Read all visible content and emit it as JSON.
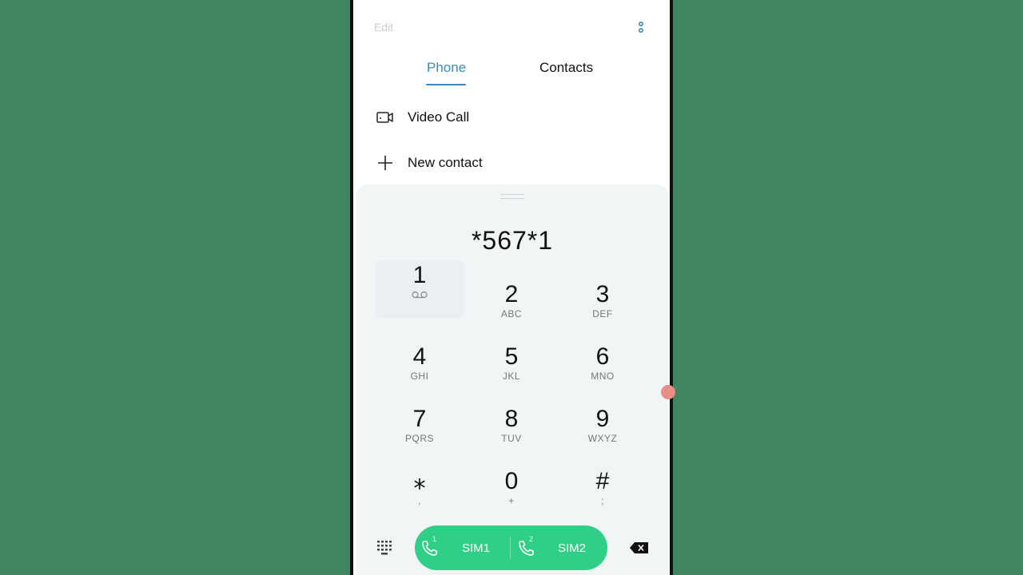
{
  "header": {
    "edit_label": "Edit",
    "more_icon": "more-vertical-icon"
  },
  "tabs": [
    {
      "label": "Phone",
      "active": true
    },
    {
      "label": "Contacts",
      "active": false
    }
  ],
  "actions": [
    {
      "label": "Video Call",
      "icon": "video-call-icon"
    },
    {
      "label": "New contact",
      "icon": "plus-icon"
    }
  ],
  "dialer": {
    "number": "*567*1",
    "keys": [
      {
        "digit": "1",
        "sub": ""
      },
      {
        "digit": "2",
        "sub": "ABC"
      },
      {
        "digit": "3",
        "sub": "DEF"
      },
      {
        "digit": "4",
        "sub": "GHI"
      },
      {
        "digit": "5",
        "sub": "JKL"
      },
      {
        "digit": "6",
        "sub": "MNO"
      },
      {
        "digit": "7",
        "sub": "PQRS"
      },
      {
        "digit": "8",
        "sub": "TUV"
      },
      {
        "digit": "9",
        "sub": "WXYZ"
      },
      {
        "digit": "⁎",
        "sub": ","
      },
      {
        "digit": "0",
        "sub": "+"
      },
      {
        "digit": "#",
        "sub": ";"
      }
    ]
  },
  "bottom": {
    "sim1_label": "SIM1",
    "sim2_label": "SIM2",
    "sim1_badge": "1",
    "sim2_badge": "2"
  },
  "colors": {
    "accent": "#3b8ac4",
    "call_green": "#2fcf87",
    "background": "#418662",
    "pad_bg": "#f1f5f6"
  }
}
